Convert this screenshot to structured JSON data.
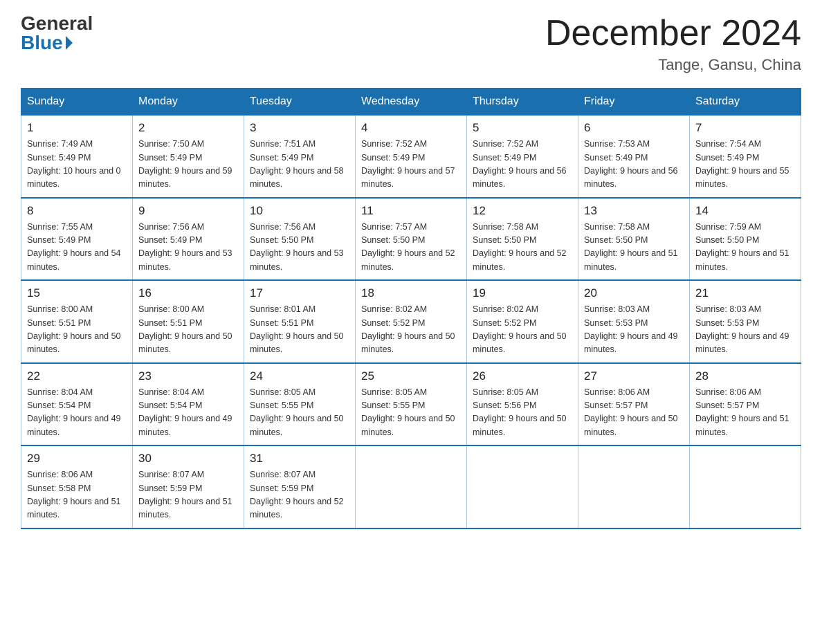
{
  "header": {
    "logo_general": "General",
    "logo_blue": "Blue",
    "month_title": "December 2024",
    "location": "Tange, Gansu, China"
  },
  "days_of_week": [
    "Sunday",
    "Monday",
    "Tuesday",
    "Wednesday",
    "Thursday",
    "Friday",
    "Saturday"
  ],
  "weeks": [
    [
      {
        "day": "1",
        "sunrise": "7:49 AM",
        "sunset": "5:49 PM",
        "daylight": "10 hours and 0 minutes."
      },
      {
        "day": "2",
        "sunrise": "7:50 AM",
        "sunset": "5:49 PM",
        "daylight": "9 hours and 59 minutes."
      },
      {
        "day": "3",
        "sunrise": "7:51 AM",
        "sunset": "5:49 PM",
        "daylight": "9 hours and 58 minutes."
      },
      {
        "day": "4",
        "sunrise": "7:52 AM",
        "sunset": "5:49 PM",
        "daylight": "9 hours and 57 minutes."
      },
      {
        "day": "5",
        "sunrise": "7:52 AM",
        "sunset": "5:49 PM",
        "daylight": "9 hours and 56 minutes."
      },
      {
        "day": "6",
        "sunrise": "7:53 AM",
        "sunset": "5:49 PM",
        "daylight": "9 hours and 56 minutes."
      },
      {
        "day": "7",
        "sunrise": "7:54 AM",
        "sunset": "5:49 PM",
        "daylight": "9 hours and 55 minutes."
      }
    ],
    [
      {
        "day": "8",
        "sunrise": "7:55 AM",
        "sunset": "5:49 PM",
        "daylight": "9 hours and 54 minutes."
      },
      {
        "day": "9",
        "sunrise": "7:56 AM",
        "sunset": "5:49 PM",
        "daylight": "9 hours and 53 minutes."
      },
      {
        "day": "10",
        "sunrise": "7:56 AM",
        "sunset": "5:50 PM",
        "daylight": "9 hours and 53 minutes."
      },
      {
        "day": "11",
        "sunrise": "7:57 AM",
        "sunset": "5:50 PM",
        "daylight": "9 hours and 52 minutes."
      },
      {
        "day": "12",
        "sunrise": "7:58 AM",
        "sunset": "5:50 PM",
        "daylight": "9 hours and 52 minutes."
      },
      {
        "day": "13",
        "sunrise": "7:58 AM",
        "sunset": "5:50 PM",
        "daylight": "9 hours and 51 minutes."
      },
      {
        "day": "14",
        "sunrise": "7:59 AM",
        "sunset": "5:50 PM",
        "daylight": "9 hours and 51 minutes."
      }
    ],
    [
      {
        "day": "15",
        "sunrise": "8:00 AM",
        "sunset": "5:51 PM",
        "daylight": "9 hours and 50 minutes."
      },
      {
        "day": "16",
        "sunrise": "8:00 AM",
        "sunset": "5:51 PM",
        "daylight": "9 hours and 50 minutes."
      },
      {
        "day": "17",
        "sunrise": "8:01 AM",
        "sunset": "5:51 PM",
        "daylight": "9 hours and 50 minutes."
      },
      {
        "day": "18",
        "sunrise": "8:02 AM",
        "sunset": "5:52 PM",
        "daylight": "9 hours and 50 minutes."
      },
      {
        "day": "19",
        "sunrise": "8:02 AM",
        "sunset": "5:52 PM",
        "daylight": "9 hours and 50 minutes."
      },
      {
        "day": "20",
        "sunrise": "8:03 AM",
        "sunset": "5:53 PM",
        "daylight": "9 hours and 49 minutes."
      },
      {
        "day": "21",
        "sunrise": "8:03 AM",
        "sunset": "5:53 PM",
        "daylight": "9 hours and 49 minutes."
      }
    ],
    [
      {
        "day": "22",
        "sunrise": "8:04 AM",
        "sunset": "5:54 PM",
        "daylight": "9 hours and 49 minutes."
      },
      {
        "day": "23",
        "sunrise": "8:04 AM",
        "sunset": "5:54 PM",
        "daylight": "9 hours and 49 minutes."
      },
      {
        "day": "24",
        "sunrise": "8:05 AM",
        "sunset": "5:55 PM",
        "daylight": "9 hours and 50 minutes."
      },
      {
        "day": "25",
        "sunrise": "8:05 AM",
        "sunset": "5:55 PM",
        "daylight": "9 hours and 50 minutes."
      },
      {
        "day": "26",
        "sunrise": "8:05 AM",
        "sunset": "5:56 PM",
        "daylight": "9 hours and 50 minutes."
      },
      {
        "day": "27",
        "sunrise": "8:06 AM",
        "sunset": "5:57 PM",
        "daylight": "9 hours and 50 minutes."
      },
      {
        "day": "28",
        "sunrise": "8:06 AM",
        "sunset": "5:57 PM",
        "daylight": "9 hours and 51 minutes."
      }
    ],
    [
      {
        "day": "29",
        "sunrise": "8:06 AM",
        "sunset": "5:58 PM",
        "daylight": "9 hours and 51 minutes."
      },
      {
        "day": "30",
        "sunrise": "8:07 AM",
        "sunset": "5:59 PM",
        "daylight": "9 hours and 51 minutes."
      },
      {
        "day": "31",
        "sunrise": "8:07 AM",
        "sunset": "5:59 PM",
        "daylight": "9 hours and 52 minutes."
      },
      null,
      null,
      null,
      null
    ]
  ]
}
